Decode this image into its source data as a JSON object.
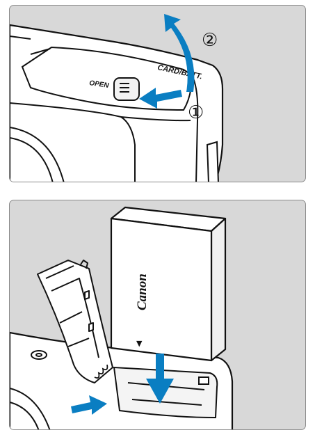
{
  "panel_open_cover": {
    "cover_label": "CARD/BATT.",
    "lever_label": "OPEN",
    "step1": "①",
    "step2": "②",
    "colors": {
      "arrow": "#0a7ec2",
      "panel_bg": "#d8d8d8",
      "line": "#111111"
    }
  },
  "panel_insert_battery": {
    "battery_brand": "Canon",
    "battery_mark": "▼",
    "colors": {
      "arrow": "#0a7ec2",
      "panel_bg": "#d8d8d8",
      "line": "#111111"
    }
  }
}
